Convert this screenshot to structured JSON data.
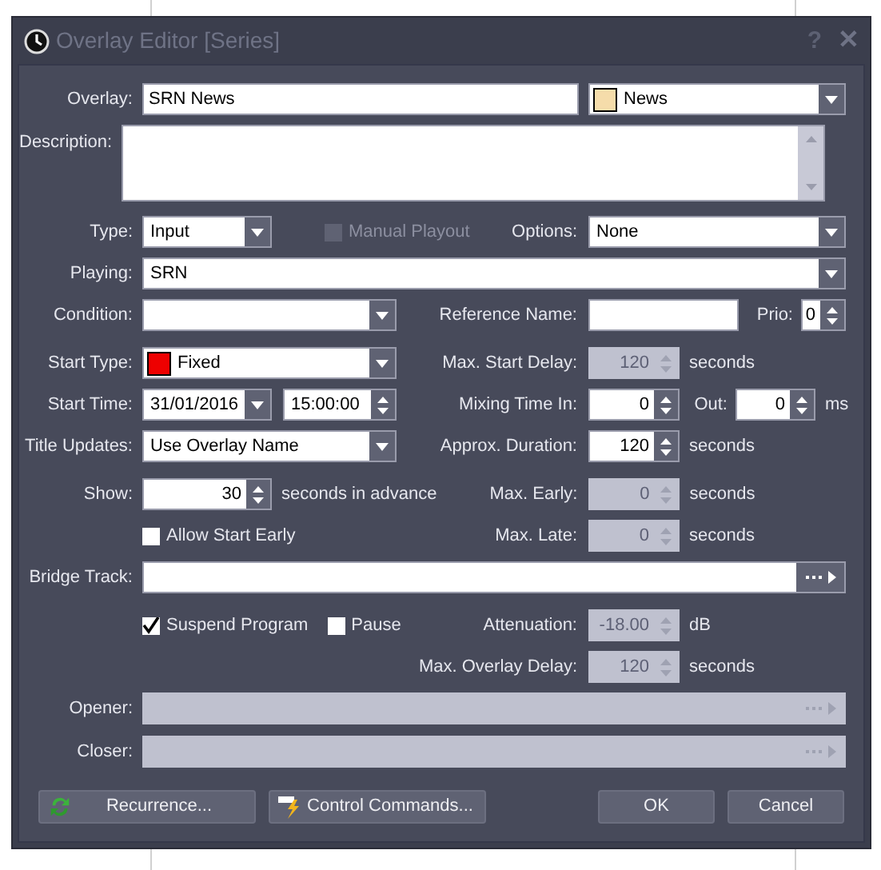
{
  "window": {
    "title": "Overlay Editor [Series]",
    "title_buttons": [
      {
        "glyph": "?",
        "kind": "help"
      },
      {
        "glyph": "✕",
        "kind": "close"
      }
    ]
  },
  "overlay": {
    "label": "Overlay:",
    "value": "SRN News",
    "category": {
      "value": "News",
      "color": "#f5dcaa"
    }
  },
  "description": {
    "label": "Description:"
  },
  "type": {
    "label": "Type:",
    "value": "Input"
  },
  "manual_playout": {
    "label": "Manual Playout",
    "checked": false,
    "disabled": true
  },
  "options": {
    "label": "Options:",
    "value": "None"
  },
  "playing": {
    "label": "Playing:",
    "value": "SRN"
  },
  "condition": {
    "label": "Condition:"
  },
  "reference_name": {
    "label": "Reference Name:"
  },
  "prio": {
    "label": "Prio:",
    "value": "0"
  },
  "start_type": {
    "label": "Start Type:",
    "value": "Fixed",
    "color": "#ee0000"
  },
  "max_start_delay": {
    "label": "Max. Start Delay:",
    "value": "120",
    "unit": "seconds",
    "disabled": true
  },
  "start_time": {
    "label": "Start Time:",
    "date": "31/01/2016",
    "time": "15:00:00"
  },
  "mixing_time_in": {
    "label": "Mixing Time In:",
    "value": "0",
    "disabled": false
  },
  "mixing_out": {
    "label": "Out:",
    "value": "0",
    "unit": "ms",
    "disabled": false
  },
  "title_updates": {
    "label": "Title Updates:",
    "value": "Use Overlay Name"
  },
  "approx_duration": {
    "label": "Approx. Duration:",
    "value": "120",
    "unit": "seconds",
    "disabled": false
  },
  "show": {
    "label": "Show:",
    "value": "30",
    "unit": "seconds in advance",
    "disabled": false
  },
  "max_early": {
    "label": "Max. Early:",
    "value": "0",
    "unit": "seconds",
    "disabled": true
  },
  "allow_start_early": {
    "label": "Allow Start Early",
    "checked": false,
    "disabled": false
  },
  "max_late": {
    "label": "Max. Late:",
    "value": "0",
    "unit": "seconds",
    "disabled": true
  },
  "bridge_track": {
    "label": "Bridge Track:",
    "disabled": false
  },
  "suspend_program": {
    "label": "Suspend Program",
    "checked": true,
    "disabled": false
  },
  "pause": {
    "label": "Pause",
    "checked": false,
    "disabled": false
  },
  "attenuation": {
    "label": "Attenuation:",
    "value": "-18.00",
    "unit": "dB",
    "disabled": true
  },
  "max_overlay_delay": {
    "label": "Max. Overlay Delay:",
    "value": "120",
    "unit": "seconds",
    "disabled": true
  },
  "opener": {
    "label": "Opener:",
    "disabled": true
  },
  "closer": {
    "label": "Closer:",
    "disabled": true
  },
  "buttons": [
    {
      "label": "Recurrence...",
      "kind": "recurrence"
    },
    {
      "label": "Control Commands...",
      "kind": "commands"
    },
    {
      "label": "OK",
      "kind": "plain"
    },
    {
      "label": "Cancel",
      "kind": "plain"
    }
  ]
}
